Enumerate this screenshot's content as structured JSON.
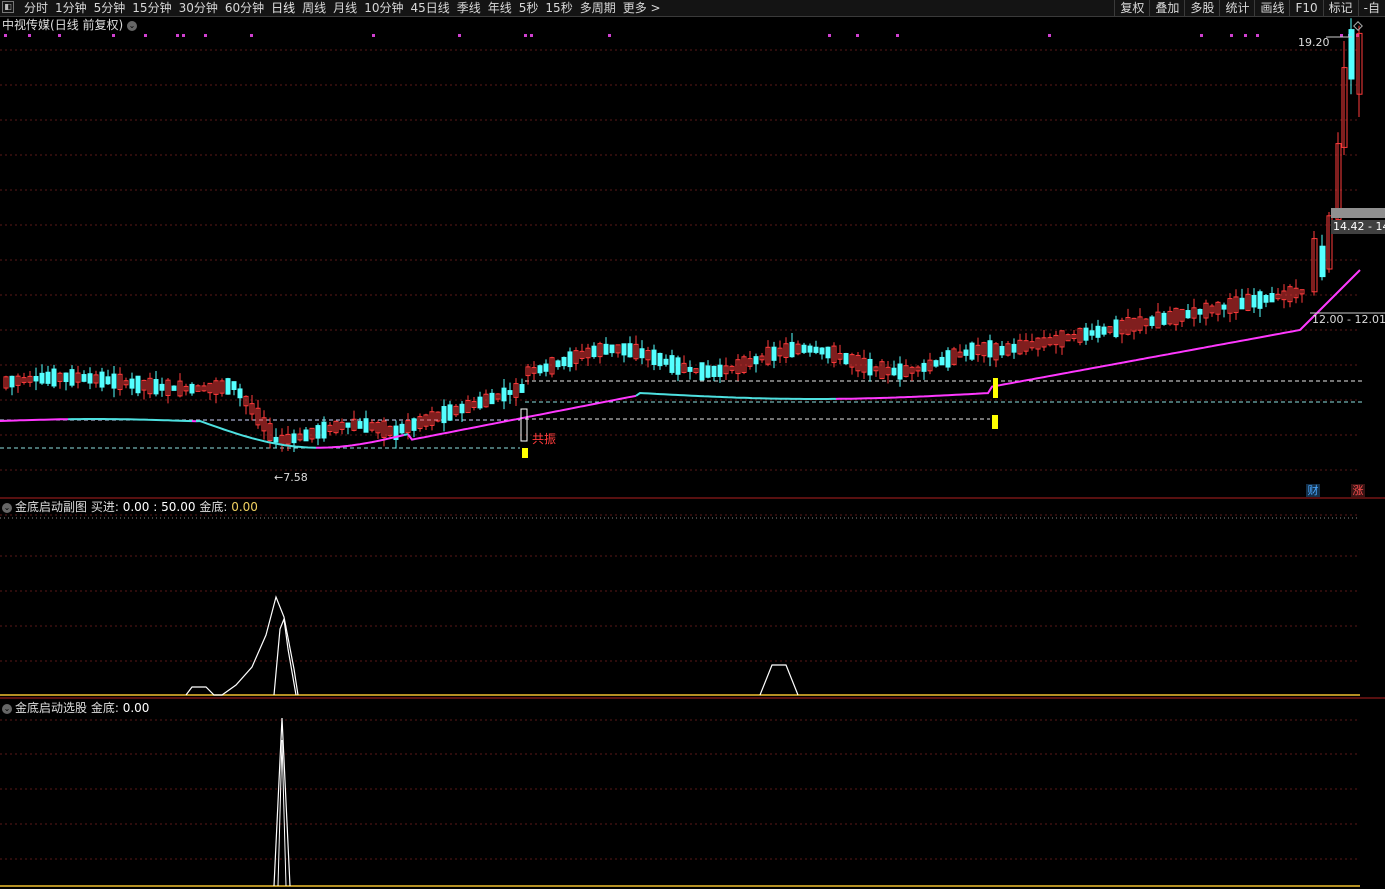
{
  "toolbar": {
    "menu_icon": "menu-icon",
    "periods": [
      "分时",
      "1分钟",
      "5分钟",
      "15分钟",
      "30分钟",
      "60分钟",
      "日线",
      "周线",
      "月线",
      "10分钟",
      "45日线",
      "季线",
      "年线",
      "5秒",
      "15秒",
      "多周期",
      "更多 >"
    ],
    "active_period": "日线",
    "tools": [
      "复权",
      "叠加",
      "多股",
      "统计",
      "画线",
      "F10",
      "标记",
      "-自"
    ]
  },
  "main_panel": {
    "stock_name": "中视传媒",
    "mode": "(日线 前复权)",
    "high_label": "19.20",
    "low_label": "←7.58",
    "signal_text": "共振",
    "box_label_1": "14.42 - 14",
    "box_label_2": "12.00 - 12.01",
    "badge_finance": "财",
    "badge_rise": "涨",
    "colors": {
      "up": "#ff3b3b",
      "down": "#54ffff",
      "ma_up": "#ff38ff",
      "ma_down": "#4ee0e0",
      "signal": "#ffff00"
    }
  },
  "sub_panel_1": {
    "title": "金底启动副图",
    "label_buy": "买进:",
    "value_buy": "0.00",
    "value_level": ": 50.00",
    "label_gold": "金底:",
    "value_gold": "0.00"
  },
  "sub_panel_2": {
    "title": "金底启动选股",
    "label_gold": "金底:",
    "value_gold": "0.00"
  }
}
